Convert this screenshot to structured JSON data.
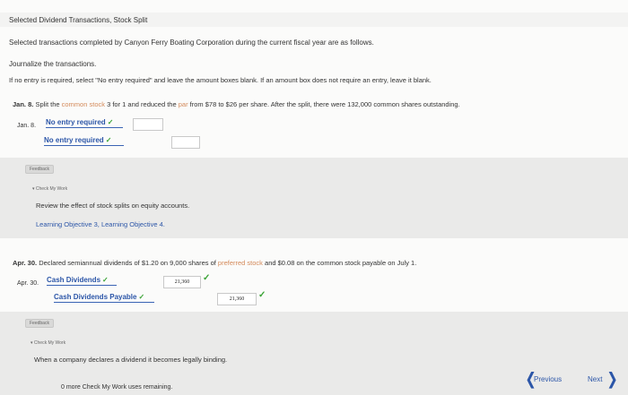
{
  "header": {
    "title": "Selected Dividend Transactions, Stock Split"
  },
  "instructions": {
    "intro": "Selected transactions completed by Canyon Ferry Boating Corporation during the current fiscal year are as follows.",
    "task": "Journalize the transactions.",
    "rule": "If no entry is required, select \"No entry required\" and leave the amount boxes blank. If an amount box does not require an entry, leave it blank."
  },
  "jan8": {
    "date_bold": "Jan. 8.",
    "text_a": " Split the ",
    "text_hl": "common stock",
    "text_b": " 3 for 1 and reduced the ",
    "text_hl2": "par",
    "text_c": " from $78 to $26 per share. After the split, there were 132,000 common shares outstanding.",
    "row_date": "Jan. 8.",
    "line1": "No entry required",
    "line2": "No entry required",
    "feedback_tab": "Feedback",
    "check_label": "▾ Check My Work",
    "feedback_text": "Review the effect of stock splits on equity accounts.",
    "objective": "Learning Objective 3, Learning Objective 4."
  },
  "apr30": {
    "date_bold": "Apr. 30.",
    "text_a": " Declared semiannual dividends of $1.20 on 9,000 shares of ",
    "text_hl": "preferred stock",
    "text_b": " and $0.08 on the common stock payable on July 1.",
    "row_date": "Apr. 30.",
    "line1": "Cash Dividends",
    "line2": "Cash Dividends Payable",
    "debit": "21,360",
    "credit": "21,360",
    "feedback_tab": "Feedback",
    "check_label": "▾ Check My Work",
    "feedback_text": "When a company declares a dividend it becomes legally binding."
  },
  "footer": {
    "remaining": "0 more Check My Work uses remaining.",
    "previous": "Previous",
    "next": "Next"
  },
  "colors": {
    "link": "#2c56a8",
    "check": "#3aa335",
    "highlight": "#d48a5a"
  }
}
